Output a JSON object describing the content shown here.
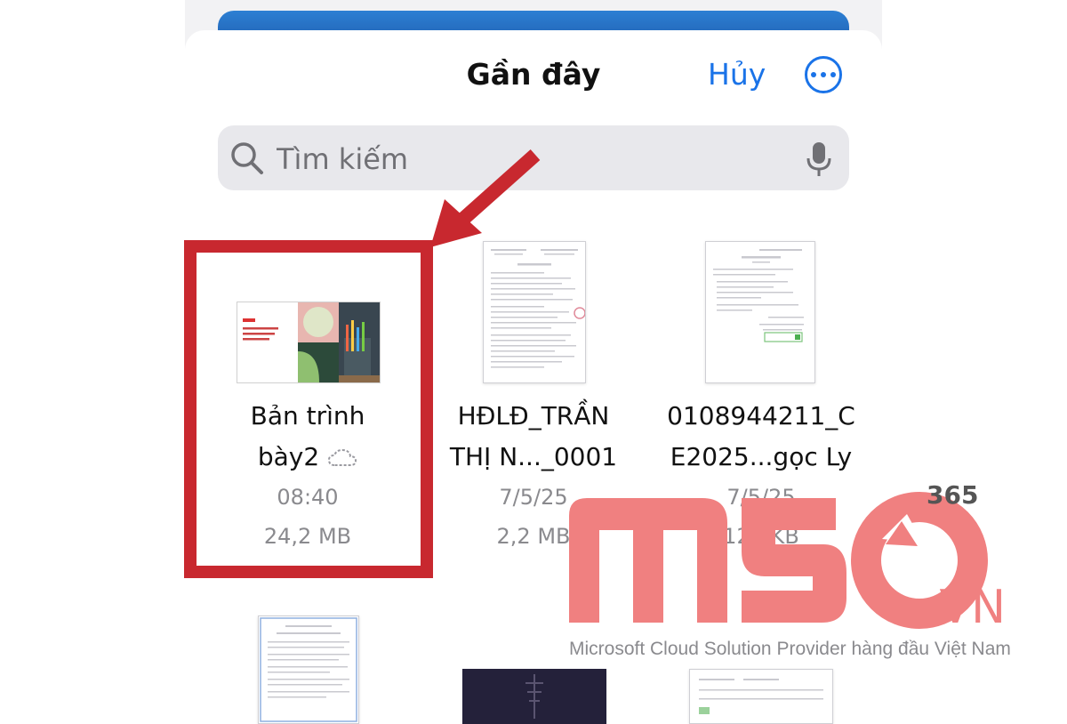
{
  "header": {
    "title": "Gần đây",
    "cancel_label": "Hủy"
  },
  "search": {
    "placeholder": "Tìm kiếm"
  },
  "files": [
    {
      "name_line1": "Bản trình",
      "name_line2": "bày2",
      "time": "08:40",
      "size": "24,2 MB",
      "cloud_icon": "cloud-download-icon"
    },
    {
      "name_line1": "HĐLĐ_TRẦN",
      "name_line2": "THỊ N..._0001",
      "time": "7/5/25",
      "size": "2,2 MB"
    },
    {
      "name_line1": "0108944211_C",
      "name_line2": "E2025...gọc Ly",
      "time": "7/5/25",
      "size": "128 KB"
    }
  ],
  "watermark": {
    "logo_text": "MSO",
    "domain_suffix": ".VN",
    "superscript": "365",
    "tagline": "Microsoft Cloud Solution Provider hàng đầu Việt Nam"
  },
  "colors": {
    "accent": "#1a73e8",
    "highlight": "#c8282f",
    "watermark": "#f08080"
  }
}
